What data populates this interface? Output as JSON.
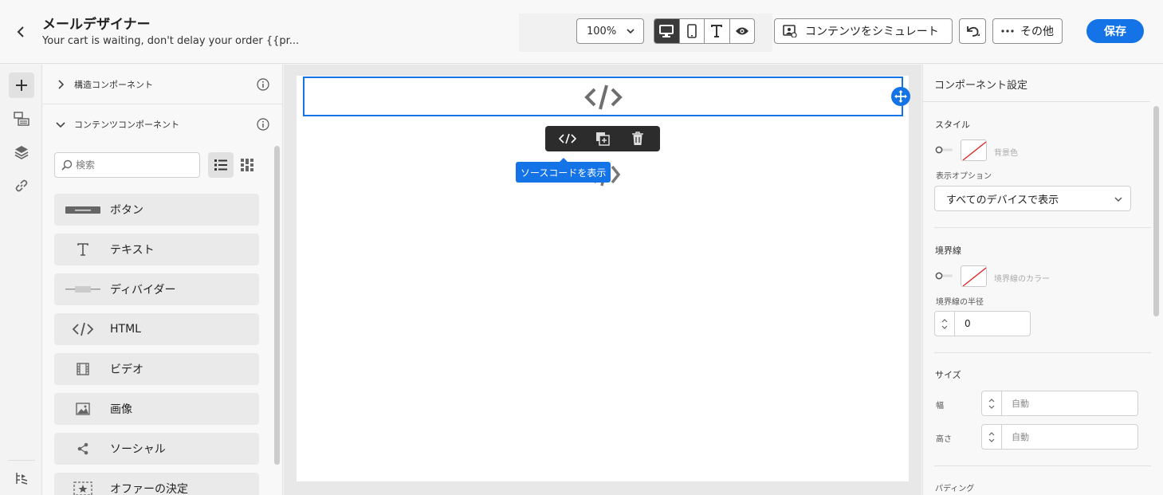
{
  "header": {
    "title": "メールデザイナー",
    "subtitle": "Your cart is waiting, don't delay your order {{pr...",
    "zoom": "100%",
    "simulate_label": "コンテンツをシミュレート",
    "more_label": "その他",
    "save_label": "保存"
  },
  "rail": {
    "items": [
      "plus-icon",
      "fragments-icon",
      "layers-icon",
      "link-icon",
      "navigation-tree-icon"
    ]
  },
  "left_panel": {
    "structure_title": "構造コンポーネント",
    "content_title": "コンテンツコンポーネント",
    "search_placeholder": "検索",
    "components": [
      {
        "label": "ボタン",
        "icon": "button-icon"
      },
      {
        "label": "テキスト",
        "icon": "text-icon"
      },
      {
        "label": "ディバイダー",
        "icon": "divider-icon"
      },
      {
        "label": "HTML",
        "icon": "html-icon"
      },
      {
        "label": "ビデオ",
        "icon": "video-icon"
      },
      {
        "label": "画像",
        "icon": "image-icon"
      },
      {
        "label": "ソーシャル",
        "icon": "social-icon"
      },
      {
        "label": "オファーの決定",
        "icon": "offer-icon"
      }
    ]
  },
  "canvas": {
    "tooltip": "ソースコードを表示"
  },
  "right_panel": {
    "title": "コンポーネント設定",
    "style_section": "スタイル",
    "bg_color_label": "背景色",
    "display_options_label": "表示オプション",
    "display_options_value": "すべてのデバイスで表示",
    "border_section": "境界線",
    "border_color_label": "境界線のカラー",
    "border_radius_label": "境界線の半径",
    "border_radius_value": "0",
    "size_section": "サイズ",
    "width_label": "幅",
    "width_placeholder": "自動",
    "height_label": "高さ",
    "height_placeholder": "自動",
    "padding_section": "パディング"
  },
  "colors": {
    "accent": "#1473e6",
    "toolbar": "#2c2c2c"
  }
}
